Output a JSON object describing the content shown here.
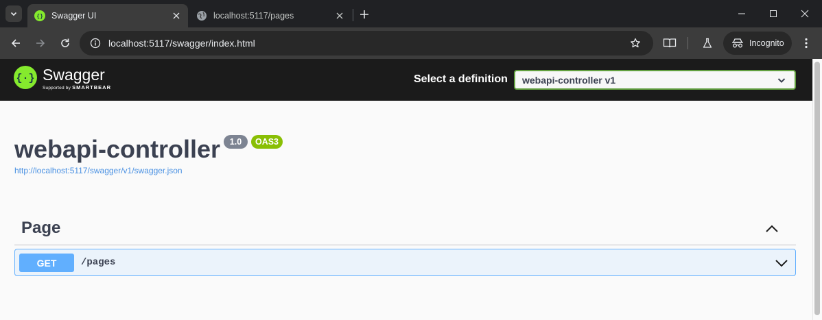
{
  "browser": {
    "tabs": [
      {
        "title": "Swagger UI",
        "icon": "swagger-favicon",
        "active": true
      },
      {
        "title": "localhost:5117/pages",
        "icon": "globe-icon",
        "active": false
      }
    ],
    "url": "localhost:5117/swagger/index.html",
    "incognito_label": "Incognito"
  },
  "swagger": {
    "brand": "Swagger",
    "brand_tagline_prefix": "Supported by",
    "brand_tagline_company": "SMARTBEAR",
    "definition_label": "Select a definition",
    "definition_selected": "webapi-controller v1",
    "title": "webapi-controller",
    "version_badge": "1.0",
    "oas_badge": "OAS3",
    "spec_url": "http://localhost:5117/swagger/v1/swagger.json",
    "sections": [
      {
        "name": "Page",
        "operations": [
          {
            "method": "GET",
            "path": "/pages"
          }
        ]
      }
    ]
  },
  "colors": {
    "accent_green": "#85ea2d",
    "get_blue": "#61affe",
    "oas_green": "#89bf04",
    "version_gray": "#7d8492"
  }
}
